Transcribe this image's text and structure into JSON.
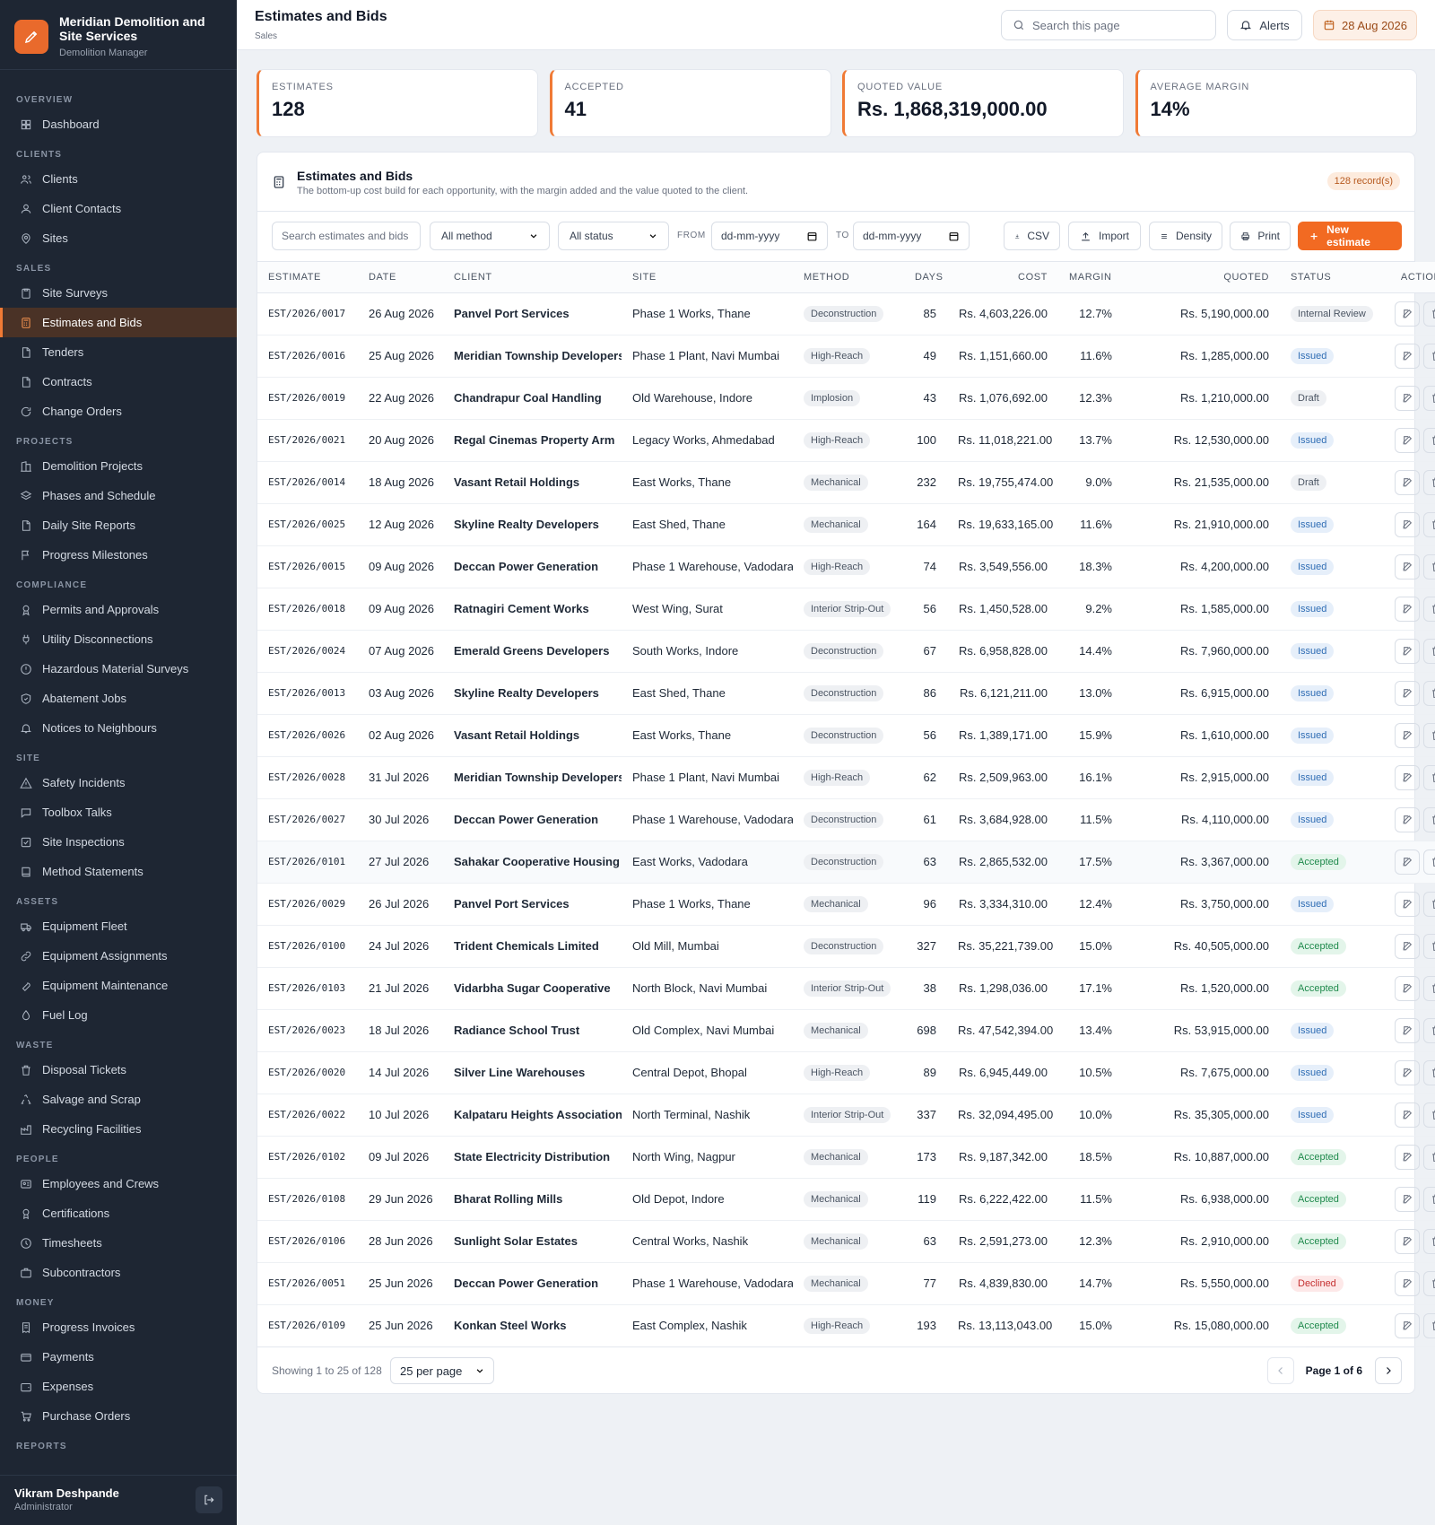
{
  "brand": {
    "title": "Meridian Demolition and Site Services",
    "subtitle": "Demolition Manager"
  },
  "nav": [
    {
      "group": "OVERVIEW",
      "items": [
        {
          "label": "Dashboard",
          "icon": "grid-icon"
        }
      ]
    },
    {
      "group": "CLIENTS",
      "items": [
        {
          "label": "Clients",
          "icon": "users-icon"
        },
        {
          "label": "Client Contacts",
          "icon": "user-icon"
        },
        {
          "label": "Sites",
          "icon": "pin-icon"
        }
      ]
    },
    {
      "group": "SALES",
      "items": [
        {
          "label": "Site Surveys",
          "icon": "clipboard-icon"
        },
        {
          "label": "Estimates and Bids",
          "icon": "calculator-icon",
          "active": true
        },
        {
          "label": "Tenders",
          "icon": "file-icon"
        },
        {
          "label": "Contracts",
          "icon": "file-icon"
        },
        {
          "label": "Change Orders",
          "icon": "refresh-icon"
        }
      ]
    },
    {
      "group": "PROJECTS",
      "items": [
        {
          "label": "Demolition Projects",
          "icon": "building-icon"
        },
        {
          "label": "Phases and Schedule",
          "icon": "layers-icon"
        },
        {
          "label": "Daily Site Reports",
          "icon": "file-icon"
        },
        {
          "label": "Progress Milestones",
          "icon": "flag-icon"
        }
      ]
    },
    {
      "group": "COMPLIANCE",
      "items": [
        {
          "label": "Permits and Approvals",
          "icon": "badge-icon"
        },
        {
          "label": "Utility Disconnections",
          "icon": "plug-icon"
        },
        {
          "label": "Hazardous Material Surveys",
          "icon": "alert-icon"
        },
        {
          "label": "Abatement Jobs",
          "icon": "shield-icon"
        },
        {
          "label": "Notices to Neighbours",
          "icon": "bell-icon"
        }
      ]
    },
    {
      "group": "SITE",
      "items": [
        {
          "label": "Safety Incidents",
          "icon": "warning-icon"
        },
        {
          "label": "Toolbox Talks",
          "icon": "chat-icon"
        },
        {
          "label": "Site Inspections",
          "icon": "checkbox-icon"
        },
        {
          "label": "Method Statements",
          "icon": "book-icon"
        }
      ]
    },
    {
      "group": "ASSETS",
      "items": [
        {
          "label": "Equipment Fleet",
          "icon": "truck-icon"
        },
        {
          "label": "Equipment Assignments",
          "icon": "link-icon"
        },
        {
          "label": "Equipment Maintenance",
          "icon": "wrench-icon"
        },
        {
          "label": "Fuel Log",
          "icon": "droplet-icon"
        }
      ]
    },
    {
      "group": "WASTE",
      "items": [
        {
          "label": "Disposal Tickets",
          "icon": "trash-icon"
        },
        {
          "label": "Salvage and Scrap",
          "icon": "recycle-icon"
        },
        {
          "label": "Recycling Facilities",
          "icon": "factory-icon"
        }
      ]
    },
    {
      "group": "PEOPLE",
      "items": [
        {
          "label": "Employees and Crews",
          "icon": "id-card-icon"
        },
        {
          "label": "Certifications",
          "icon": "award-icon"
        },
        {
          "label": "Timesheets",
          "icon": "clock-icon"
        },
        {
          "label": "Subcontractors",
          "icon": "briefcase-icon"
        }
      ]
    },
    {
      "group": "MONEY",
      "items": [
        {
          "label": "Progress Invoices",
          "icon": "receipt-icon"
        },
        {
          "label": "Payments",
          "icon": "card-icon"
        },
        {
          "label": "Expenses",
          "icon": "wallet-icon"
        },
        {
          "label": "Purchase Orders",
          "icon": "cart-icon"
        }
      ]
    },
    {
      "group": "REPORTS",
      "items": []
    }
  ],
  "user": {
    "name": "Vikram Deshpande",
    "role": "Administrator"
  },
  "header": {
    "title": "Estimates and Bids",
    "crumb": "Sales",
    "search_placeholder": "Search this page",
    "alerts_label": "Alerts",
    "date_label": "28 Aug 2026"
  },
  "stats": [
    {
      "label": "ESTIMATES",
      "value": "128"
    },
    {
      "label": "ACCEPTED",
      "value": "41"
    },
    {
      "label": "QUOTED VALUE",
      "value": "Rs. 1,868,319,000.00"
    },
    {
      "label": "AVERAGE MARGIN",
      "value": "14%"
    }
  ],
  "card": {
    "title": "Estimates and Bids",
    "subtitle": "The bottom-up cost build for each opportunity, with the margin added and the value quoted to the client.",
    "record_badge": "128 record(s)"
  },
  "toolbar": {
    "search_placeholder": "Search estimates and bids",
    "method_value": "All method",
    "status_value": "All status",
    "from_label": "FROM",
    "to_label": "TO",
    "from_placeholder": "dd-mm-yyyy",
    "to_placeholder": "dd-mm-yyyy",
    "csv_label": "CSV",
    "import_label": "Import",
    "density_label": "Density",
    "print_label": "Print",
    "new_label": "New estimate"
  },
  "table": {
    "columns": [
      "ESTIMATE",
      "DATE",
      "CLIENT",
      "SITE",
      "METHOD",
      "DAYS",
      "COST",
      "MARGIN",
      "QUOTED",
      "STATUS",
      "ACTIONS"
    ],
    "rows": [
      {
        "estimate": "EST/2026/0017",
        "date": "26 Aug 2026",
        "client": "Panvel Port Services",
        "site": "Phase 1 Works, Thane",
        "method": "Deconstruction",
        "days": "85",
        "cost": "Rs. 4,603,226.00",
        "margin": "12.7%",
        "quoted": "Rs. 5,190,000.00",
        "status": "Internal Review"
      },
      {
        "estimate": "EST/2026/0016",
        "date": "25 Aug 2026",
        "client": "Meridian Township Developers",
        "site": "Phase 1 Plant, Navi Mumbai",
        "method": "High-Reach",
        "days": "49",
        "cost": "Rs. 1,151,660.00",
        "margin": "11.6%",
        "quoted": "Rs. 1,285,000.00",
        "status": "Issued"
      },
      {
        "estimate": "EST/2026/0019",
        "date": "22 Aug 2026",
        "client": "Chandrapur Coal Handling",
        "site": "Old Warehouse, Indore",
        "method": "Implosion",
        "days": "43",
        "cost": "Rs. 1,076,692.00",
        "margin": "12.3%",
        "quoted": "Rs. 1,210,000.00",
        "status": "Draft"
      },
      {
        "estimate": "EST/2026/0021",
        "date": "20 Aug 2026",
        "client": "Regal Cinemas Property Arm",
        "site": "Legacy Works, Ahmedabad",
        "method": "High-Reach",
        "days": "100",
        "cost": "Rs. 11,018,221.00",
        "margin": "13.7%",
        "quoted": "Rs. 12,530,000.00",
        "status": "Issued"
      },
      {
        "estimate": "EST/2026/0014",
        "date": "18 Aug 2026",
        "client": "Vasant Retail Holdings",
        "site": "East Works, Thane",
        "method": "Mechanical",
        "days": "232",
        "cost": "Rs. 19,755,474.00",
        "margin": "9.0%",
        "quoted": "Rs. 21,535,000.00",
        "status": "Draft"
      },
      {
        "estimate": "EST/2026/0025",
        "date": "12 Aug 2026",
        "client": "Skyline Realty Developers",
        "site": "East Shed, Thane",
        "method": "Mechanical",
        "days": "164",
        "cost": "Rs. 19,633,165.00",
        "margin": "11.6%",
        "quoted": "Rs. 21,910,000.00",
        "status": "Issued"
      },
      {
        "estimate": "EST/2026/0015",
        "date": "09 Aug 2026",
        "client": "Deccan Power Generation",
        "site": "Phase 1 Warehouse, Vadodara",
        "method": "High-Reach",
        "days": "74",
        "cost": "Rs. 3,549,556.00",
        "margin": "18.3%",
        "quoted": "Rs. 4,200,000.00",
        "status": "Issued"
      },
      {
        "estimate": "EST/2026/0018",
        "date": "09 Aug 2026",
        "client": "Ratnagiri Cement Works",
        "site": "West Wing, Surat",
        "method": "Interior Strip-Out",
        "days": "56",
        "cost": "Rs. 1,450,528.00",
        "margin": "9.2%",
        "quoted": "Rs. 1,585,000.00",
        "status": "Issued"
      },
      {
        "estimate": "EST/2026/0024",
        "date": "07 Aug 2026",
        "client": "Emerald Greens Developers",
        "site": "South Works, Indore",
        "method": "Deconstruction",
        "days": "67",
        "cost": "Rs. 6,958,828.00",
        "margin": "14.4%",
        "quoted": "Rs. 7,960,000.00",
        "status": "Issued"
      },
      {
        "estimate": "EST/2026/0013",
        "date": "03 Aug 2026",
        "client": "Skyline Realty Developers",
        "site": "East Shed, Thane",
        "method": "Deconstruction",
        "days": "86",
        "cost": "Rs. 6,121,211.00",
        "margin": "13.0%",
        "quoted": "Rs. 6,915,000.00",
        "status": "Issued"
      },
      {
        "estimate": "EST/2026/0026",
        "date": "02 Aug 2026",
        "client": "Vasant Retail Holdings",
        "site": "East Works, Thane",
        "method": "Deconstruction",
        "days": "56",
        "cost": "Rs. 1,389,171.00",
        "margin": "15.9%",
        "quoted": "Rs. 1,610,000.00",
        "status": "Issued"
      },
      {
        "estimate": "EST/2026/0028",
        "date": "31 Jul 2026",
        "client": "Meridian Township Developers",
        "site": "Phase 1 Plant, Navi Mumbai",
        "method": "High-Reach",
        "days": "62",
        "cost": "Rs. 2,509,963.00",
        "margin": "16.1%",
        "quoted": "Rs. 2,915,000.00",
        "status": "Issued"
      },
      {
        "estimate": "EST/2026/0027",
        "date": "30 Jul 2026",
        "client": "Deccan Power Generation",
        "site": "Phase 1 Warehouse, Vadodara",
        "method": "Deconstruction",
        "days": "61",
        "cost": "Rs. 3,684,928.00",
        "margin": "11.5%",
        "quoted": "Rs. 4,110,000.00",
        "status": "Issued"
      },
      {
        "estimate": "EST/2026/0101",
        "date": "27 Jul 2026",
        "client": "Sahakar Cooperative Housing",
        "site": "East Works, Vadodara",
        "method": "Deconstruction",
        "days": "63",
        "cost": "Rs. 2,865,532.00",
        "margin": "17.5%",
        "quoted": "Rs. 3,367,000.00",
        "status": "Accepted"
      },
      {
        "estimate": "EST/2026/0029",
        "date": "26 Jul 2026",
        "client": "Panvel Port Services",
        "site": "Phase 1 Works, Thane",
        "method": "Mechanical",
        "days": "96",
        "cost": "Rs. 3,334,310.00",
        "margin": "12.4%",
        "quoted": "Rs. 3,750,000.00",
        "status": "Issued"
      },
      {
        "estimate": "EST/2026/0100",
        "date": "24 Jul 2026",
        "client": "Trident Chemicals Limited",
        "site": "Old Mill, Mumbai",
        "method": "Deconstruction",
        "days": "327",
        "cost": "Rs. 35,221,739.00",
        "margin": "15.0%",
        "quoted": "Rs. 40,505,000.00",
        "status": "Accepted"
      },
      {
        "estimate": "EST/2026/0103",
        "date": "21 Jul 2026",
        "client": "Vidarbha Sugar Cooperative",
        "site": "North Block, Navi Mumbai",
        "method": "Interior Strip-Out",
        "days": "38",
        "cost": "Rs. 1,298,036.00",
        "margin": "17.1%",
        "quoted": "Rs. 1,520,000.00",
        "status": "Accepted"
      },
      {
        "estimate": "EST/2026/0023",
        "date": "18 Jul 2026",
        "client": "Radiance School Trust",
        "site": "Old Complex, Navi Mumbai",
        "method": "Mechanical",
        "days": "698",
        "cost": "Rs. 47,542,394.00",
        "margin": "13.4%",
        "quoted": "Rs. 53,915,000.00",
        "status": "Issued"
      },
      {
        "estimate": "EST/2026/0020",
        "date": "14 Jul 2026",
        "client": "Silver Line Warehouses",
        "site": "Central Depot, Bhopal",
        "method": "High-Reach",
        "days": "89",
        "cost": "Rs. 6,945,449.00",
        "margin": "10.5%",
        "quoted": "Rs. 7,675,000.00",
        "status": "Issued"
      },
      {
        "estimate": "EST/2026/0022",
        "date": "10 Jul 2026",
        "client": "Kalpataru Heights Association",
        "site": "North Terminal, Nashik",
        "method": "Interior Strip-Out",
        "days": "337",
        "cost": "Rs. 32,094,495.00",
        "margin": "10.0%",
        "quoted": "Rs. 35,305,000.00",
        "status": "Issued"
      },
      {
        "estimate": "EST/2026/0102",
        "date": "09 Jul 2026",
        "client": "State Electricity Distribution",
        "site": "North Wing, Nagpur",
        "method": "Mechanical",
        "days": "173",
        "cost": "Rs. 9,187,342.00",
        "margin": "18.5%",
        "quoted": "Rs. 10,887,000.00",
        "status": "Accepted"
      },
      {
        "estimate": "EST/2026/0108",
        "date": "29 Jun 2026",
        "client": "Bharat Rolling Mills",
        "site": "Old Depot, Indore",
        "method": "Mechanical",
        "days": "119",
        "cost": "Rs. 6,222,422.00",
        "margin": "11.5%",
        "quoted": "Rs. 6,938,000.00",
        "status": "Accepted"
      },
      {
        "estimate": "EST/2026/0106",
        "date": "28 Jun 2026",
        "client": "Sunlight Solar Estates",
        "site": "Central Works, Nashik",
        "method": "Mechanical",
        "days": "63",
        "cost": "Rs. 2,591,273.00",
        "margin": "12.3%",
        "quoted": "Rs. 2,910,000.00",
        "status": "Accepted"
      },
      {
        "estimate": "EST/2026/0051",
        "date": "25 Jun 2026",
        "client": "Deccan Power Generation",
        "site": "Phase 1 Warehouse, Vadodara",
        "method": "Mechanical",
        "days": "77",
        "cost": "Rs. 4,839,830.00",
        "margin": "14.7%",
        "quoted": "Rs. 5,550,000.00",
        "status": "Declined"
      },
      {
        "estimate": "EST/2026/0109",
        "date": "25 Jun 2026",
        "client": "Konkan Steel Works",
        "site": "East Complex, Nashik",
        "method": "High-Reach",
        "days": "193",
        "cost": "Rs. 13,113,043.00",
        "margin": "15.0%",
        "quoted": "Rs. 15,080,000.00",
        "status": "Accepted"
      }
    ]
  },
  "status_colors": {
    "Internal Review": {
      "bg": "#eef0f3",
      "fg": "#4b5563"
    },
    "Issued": {
      "bg": "#e6effa",
      "fg": "#2f6db4"
    },
    "Draft": {
      "bg": "#eef0f3",
      "fg": "#4b5563"
    },
    "Accepted": {
      "bg": "#e3f5ea",
      "fg": "#1f8a4c"
    },
    "Declined": {
      "bg": "#fde8e8",
      "fg": "#c53030"
    }
  },
  "footer": {
    "showing": "Showing 1 to 25 of 128",
    "per_page": "25 per page",
    "page_label": "Page 1 of 6"
  },
  "colors": {
    "accent": "#f26a22",
    "sidebar": "#1e2633"
  }
}
